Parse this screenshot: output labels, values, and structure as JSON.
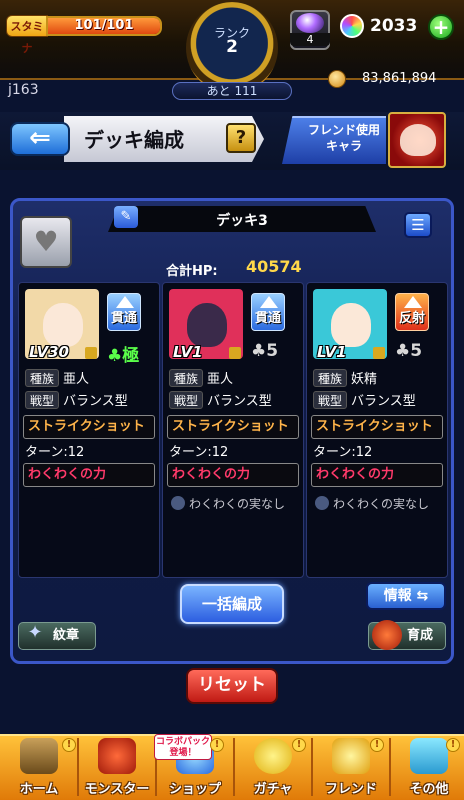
{
  "header": {
    "stamina_label": "スタミナ",
    "stamina_text": "101/101",
    "stamina_fraction": 1.0,
    "rank_label": "ランク",
    "rank_value": "2",
    "rank_next": "あと 111",
    "orb_count": "4",
    "crystal_count": "2033",
    "plus_label": "+",
    "coin_count": "83,861,894",
    "user_id": "j163"
  },
  "title_bar": {
    "back_label": "⇐",
    "page_title": "デッキ編成",
    "help_label": "?",
    "friend_label": "フレンド使用\nキャラ"
  },
  "deck": {
    "name": "デッキ3",
    "hp_label": "合計HP:",
    "hp_value": "40574",
    "edit_icon": "✎",
    "list_icon": "☰",
    "heart_icon": "♥"
  },
  "monsters": [
    {
      "level": "LV30",
      "ability": "貫通",
      "rarity": "♣極",
      "race_tag": "種族",
      "race": "亜人",
      "type_tag": "戦型",
      "type": "バランス型",
      "skill": "ストライクショット",
      "turn": "ターン:12",
      "special": "わくわくの力",
      "fruit": "",
      "portrait_color": "#f2d9a8",
      "face_color": "#fbe8d8"
    },
    {
      "level": "LV1",
      "ability": "貫通",
      "rarity": "♣5",
      "race_tag": "種族",
      "race": "亜人",
      "type_tag": "戦型",
      "type": "バランス型",
      "skill": "ストライクショット",
      "turn": "ターン:12",
      "special": "わくわくの力",
      "fruit": "わくわくの実なし",
      "portrait_color": "#e0305a",
      "face_color": "#3a2a4a"
    },
    {
      "level": "LV1",
      "ability": "反射",
      "rarity": "♣5",
      "race_tag": "種族",
      "race": "妖精",
      "type_tag": "戦型",
      "type": "バランス型",
      "skill": "ストライクショット",
      "turn": "ターン:12",
      "special": "わくわくの力",
      "fruit": "わくわくの実なし",
      "portrait_color": "#3ac8d8",
      "face_color": "#fbe8d8"
    }
  ],
  "controls": {
    "bulk_label": "一括編成",
    "info_label": "情報 ⇆",
    "emblem_label": "紋章",
    "grow_label": "育成",
    "reset_label": "リセット"
  },
  "nav": {
    "collab_badge": "コラボパック\n登場！",
    "items": [
      {
        "label": "ホーム"
      },
      {
        "label": "モンスター"
      },
      {
        "label": "ショップ"
      },
      {
        "label": "ガチャ"
      },
      {
        "label": "フレンド"
      },
      {
        "label": "その他"
      }
    ]
  }
}
